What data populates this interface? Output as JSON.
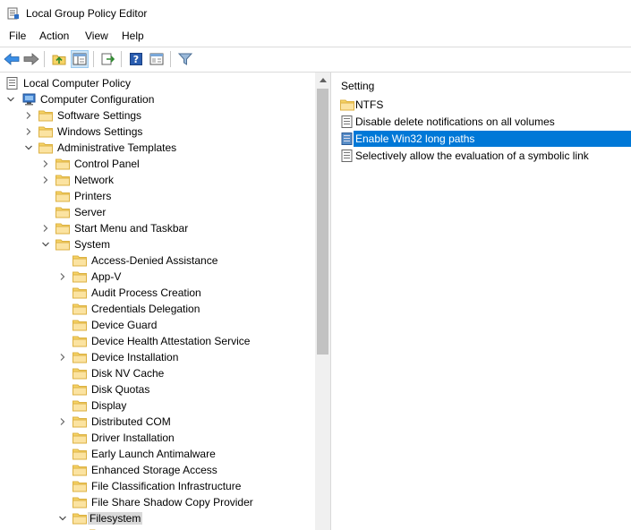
{
  "window": {
    "title": "Local Group Policy Editor"
  },
  "menu": [
    "File",
    "Action",
    "View",
    "Help"
  ],
  "toolbar": {
    "buttons": [
      "back-icon",
      "forward-icon",
      "up-folder-icon",
      "show-hide-tree-icon",
      "export-list-icon",
      "help-icon",
      "properties-icon",
      "filter-icon"
    ]
  },
  "tree": {
    "root": "Local Computer Policy",
    "computer_config": "Computer Configuration",
    "software_settings": "Software Settings",
    "windows_settings": "Windows Settings",
    "admin_templates": "Administrative Templates",
    "control_panel": "Control Panel",
    "network": "Network",
    "printers": "Printers",
    "server": "Server",
    "start_menu": "Start Menu and Taskbar",
    "system": "System",
    "system_children": [
      "Access-Denied Assistance",
      "App-V",
      "Audit Process Creation",
      "Credentials Delegation",
      "Device Guard",
      "Device Health Attestation Service",
      "Device Installation",
      "Disk NV Cache",
      "Disk Quotas",
      "Display",
      "Distributed COM",
      "Driver Installation",
      "Early Launch Antimalware",
      "Enhanced Storage Access",
      "File Classification Infrastructure",
      "File Share Shadow Copy Provider",
      "Filesystem"
    ]
  },
  "list": {
    "header": "Setting",
    "items": [
      "NTFS",
      "Disable delete notifications on all volumes",
      "Enable Win32 long paths",
      "Selectively allow the evaluation of a symbolic link"
    ]
  },
  "colors": {
    "folder": "#f6d365",
    "folder_dark": "#dcb142",
    "selection": "#0078d7",
    "tree_selection": "#d9d9d9"
  }
}
